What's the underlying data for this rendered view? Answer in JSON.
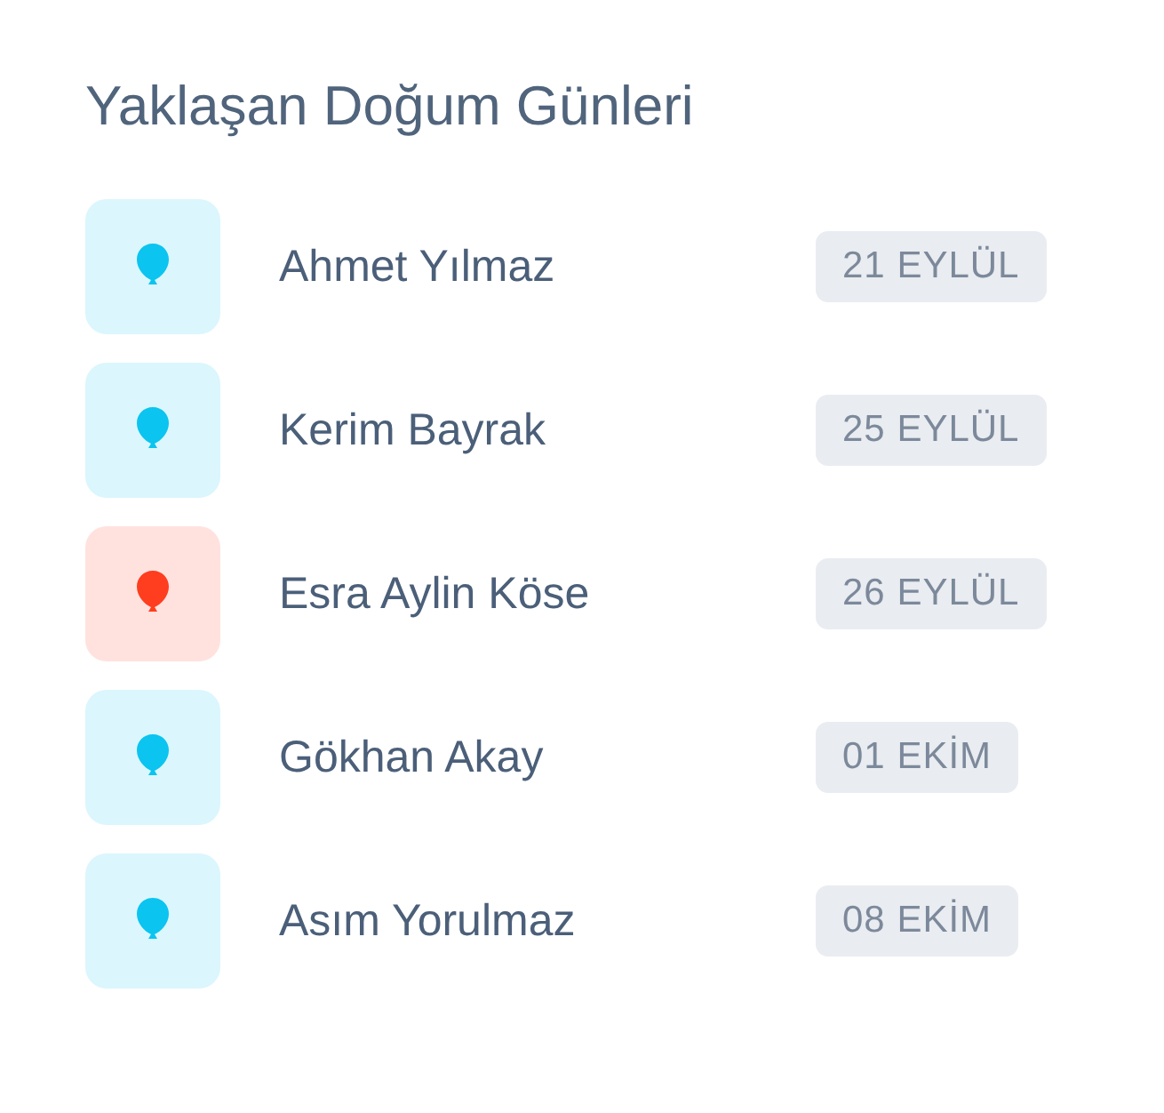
{
  "title": "Yaklaşan Doğum Günleri",
  "birthdays": [
    {
      "name": "Ahmet Yılmaz",
      "date": "21 EYLÜL",
      "color": "#0bc4f0"
    },
    {
      "name": "Kerim Bayrak",
      "date": "25 EYLÜL",
      "color": "#0bc4f0"
    },
    {
      "name": "Esra Aylin Köse",
      "date": "26 EYLÜL",
      "color": "#ff3d1f"
    },
    {
      "name": "Gökhan Akay",
      "date": "01 EKİM",
      "color": "#0bc4f0"
    },
    {
      "name": "Asım Yorulmaz",
      "date": "08 EKİM",
      "color": "#0bc4f0"
    }
  ]
}
